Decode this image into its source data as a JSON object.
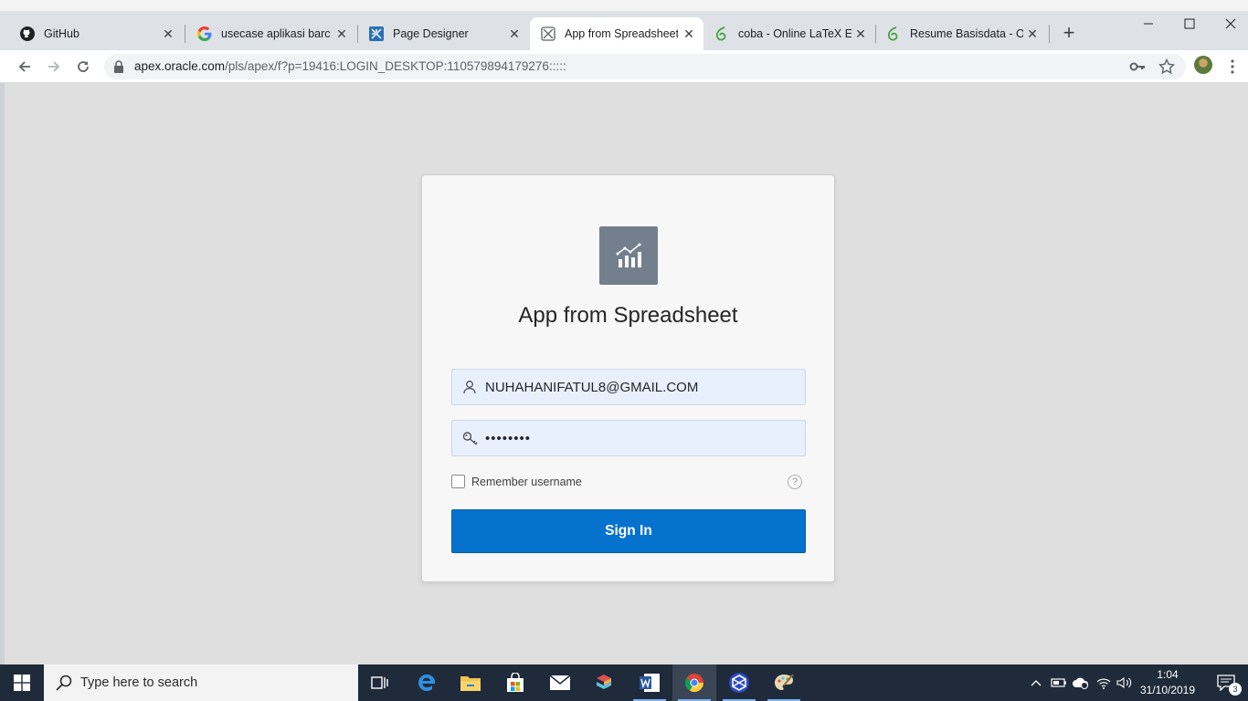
{
  "browser": {
    "tabs": [
      {
        "label": "GitHub",
        "icon": "github-icon"
      },
      {
        "label": "usecase aplikasi barcode",
        "icon": "google-icon"
      },
      {
        "label": "Page Designer",
        "icon": "page-designer-icon"
      },
      {
        "label": "App from Spreadsheet",
        "icon": "apex-app-icon",
        "active": true
      },
      {
        "label": "coba - Online LaTeX Editor",
        "icon": "overleaf-icon"
      },
      {
        "label": "Resume Basisdata - Online",
        "icon": "overleaf-icon"
      }
    ],
    "close_glyph": "✕",
    "new_tab_glyph": "+",
    "url_host": "apex.oracle.com",
    "url_path": "/pls/apex/f?p=19416:LOGIN_DESKTOP:110579894179276:::::"
  },
  "login": {
    "app_title": "App from Spreadsheet",
    "username_value": "NUHAHANIFATUL8@GMAIL.COM",
    "password_value": "••••••••",
    "remember_label": "Remember username",
    "remember_checked": false,
    "help_glyph": "?",
    "signin_label": "Sign In"
  },
  "taskbar": {
    "search_placeholder": "Type here to search",
    "time": "1:04",
    "date": "31/10/2019",
    "notification_count": "3"
  },
  "colors": {
    "accent": "#0572ce",
    "field_bg": "#e8f0fe",
    "logo_bg": "#737f8c",
    "taskbar_bg": "#1f2a3a"
  }
}
